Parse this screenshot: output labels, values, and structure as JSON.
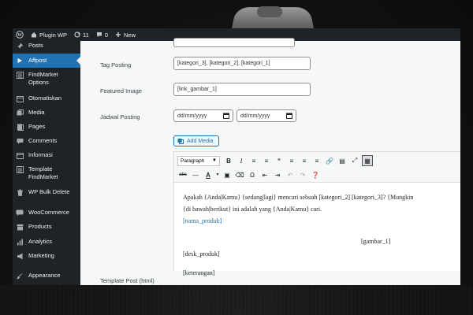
{
  "adminbar": {
    "site_name": "Plugin WP",
    "updates_count": "11",
    "comments_count": "0",
    "new_label": "New"
  },
  "sidebar": {
    "items": [
      {
        "label": "Posts",
        "icon": "pin-icon"
      },
      {
        "label": "Affpost",
        "icon": "play-icon",
        "active": true
      },
      {
        "label": "FindMarket Options",
        "icon": "list-icon"
      },
      {
        "label": "Otomatiskan",
        "icon": "calendar-icon"
      },
      {
        "label": "Media",
        "icon": "media-icon"
      },
      {
        "label": "Pages",
        "icon": "page-icon"
      },
      {
        "label": "Comments",
        "icon": "comment-icon"
      },
      {
        "label": "Informasi",
        "icon": "calendar-icon"
      },
      {
        "label": "Template FindMarket",
        "icon": "list-icon"
      },
      {
        "label": "WP Bulk Delete",
        "icon": "trash-icon"
      },
      {
        "label": "WooCommerce",
        "icon": "woo-icon"
      },
      {
        "label": "Products",
        "icon": "archive-icon"
      },
      {
        "label": "Analytics",
        "icon": "chart-icon"
      },
      {
        "label": "Marketing",
        "icon": "megaphone-icon"
      },
      {
        "label": "Appearance",
        "icon": "brush-icon"
      }
    ]
  },
  "form": {
    "tag_label": "Tag Posting",
    "tag_value": "[kategori_3], [kategori_2], [kategori_1]",
    "featured_label": "Featured Image",
    "featured_value": "[link_gambar_1]",
    "jadwal_label": "Jadwal Posting",
    "date1_value": "dd/mm/yyyy",
    "date2_value": "dd/mm/yyyy",
    "template_label": "Template Post (html)"
  },
  "editor": {
    "add_media_label": "Add Media",
    "format_select": "Paragraph",
    "lines": {
      "l1": "Apakah {Anda|Kamu} {sedang|lagi} mencari sebuah [kategori_2] [kategori_3]? {Mungkin",
      "l2": "{di bawah|berikut} ini adalah yang {Anda|Kamu} cari.",
      "l3": "[nama_produk]",
      "l4": "[gambar_1]",
      "l5": "[desk_produk]",
      "l6": "[keterangan]"
    }
  },
  "colors": {
    "admin_dark": "#1d2327",
    "accent": "#2271b1",
    "background": "#f6f7f7"
  }
}
